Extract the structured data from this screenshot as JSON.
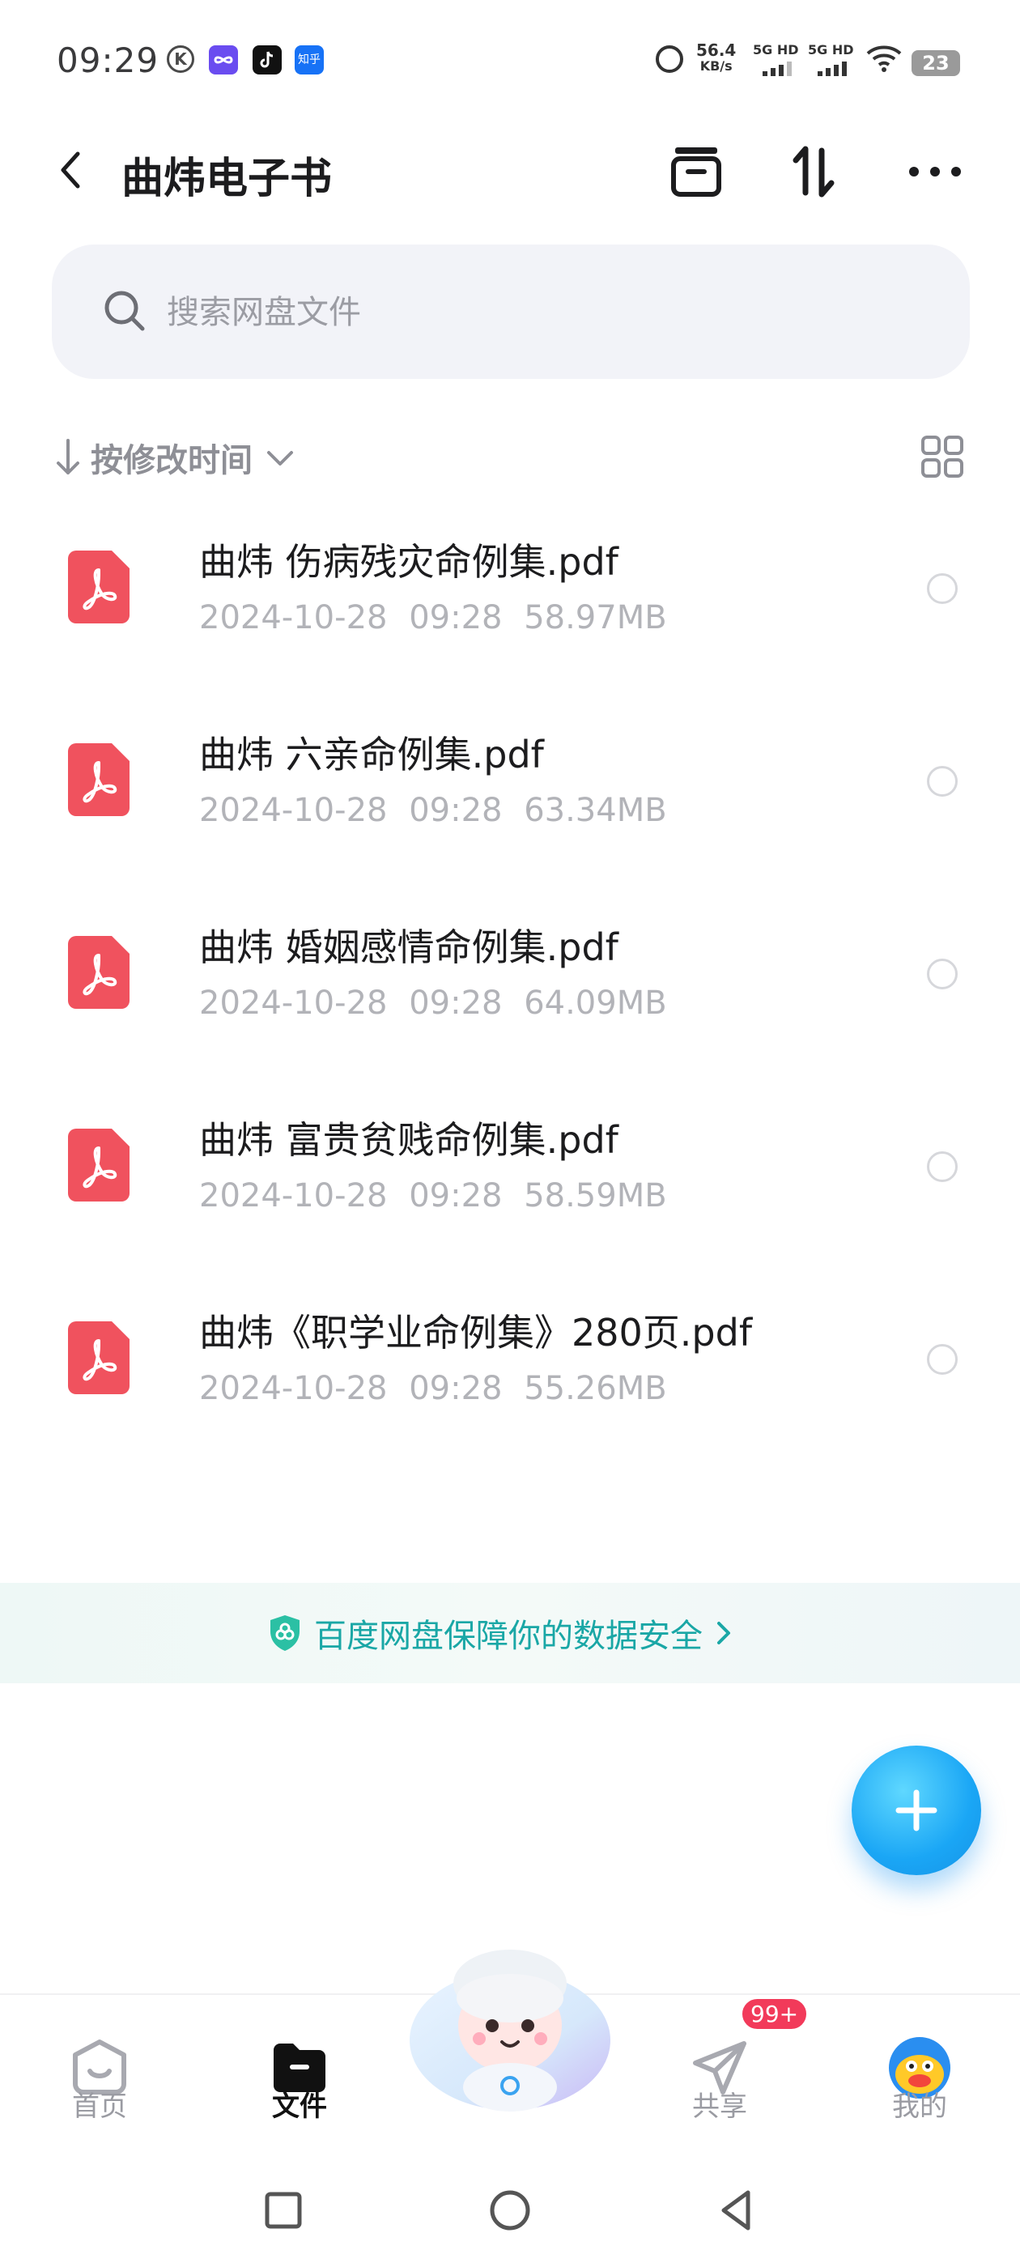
{
  "status_bar": {
    "time": "09:29",
    "k_badge": "K",
    "zhihu_badge": "知乎",
    "net_speed_value": "56.4",
    "net_speed_unit": "KB/s",
    "sim1": "5G HD",
    "sim2": "5G HD",
    "battery": "23"
  },
  "header": {
    "title": "曲炜电子书",
    "icons": [
      "back-icon",
      "archive-icon",
      "sort-icon",
      "more-icon"
    ]
  },
  "search": {
    "placeholder": "搜索网盘文件"
  },
  "sort": {
    "label": "按修改时间"
  },
  "files": [
    {
      "name": "曲炜 伤病残灾命例集.pdf",
      "date": "2024-10-28",
      "time": "09:28",
      "size": "58.97MB"
    },
    {
      "name": "曲炜 六亲命例集.pdf",
      "date": "2024-10-28",
      "time": "09:28",
      "size": "63.34MB"
    },
    {
      "name": "曲炜 婚姻感情命例集.pdf",
      "date": "2024-10-28",
      "time": "09:28",
      "size": "64.09MB"
    },
    {
      "name": "曲炜 富贵贫贱命例集.pdf",
      "date": "2024-10-28",
      "time": "09:28",
      "size": "58.59MB"
    },
    {
      "name": "曲炜《职学业命例集》280页.pdf",
      "date": "2024-10-28",
      "time": "09:28",
      "size": "55.26MB"
    }
  ],
  "safety_banner": {
    "text": "百度网盘保障你的数据安全"
  },
  "tabs": [
    {
      "label": "首页",
      "icon": "home-icon"
    },
    {
      "label": "文件",
      "icon": "folder-icon"
    },
    {
      "label": "共享",
      "icon": "paper-plane-icon",
      "badge": "99+"
    },
    {
      "label": "我的",
      "icon": "avatar-icon"
    }
  ],
  "colors": {
    "accent": "#1aa6f5",
    "pdf_red": "#f0525e",
    "safety_teal": "#1aa7a6",
    "badge_red": "#f23a5a"
  }
}
